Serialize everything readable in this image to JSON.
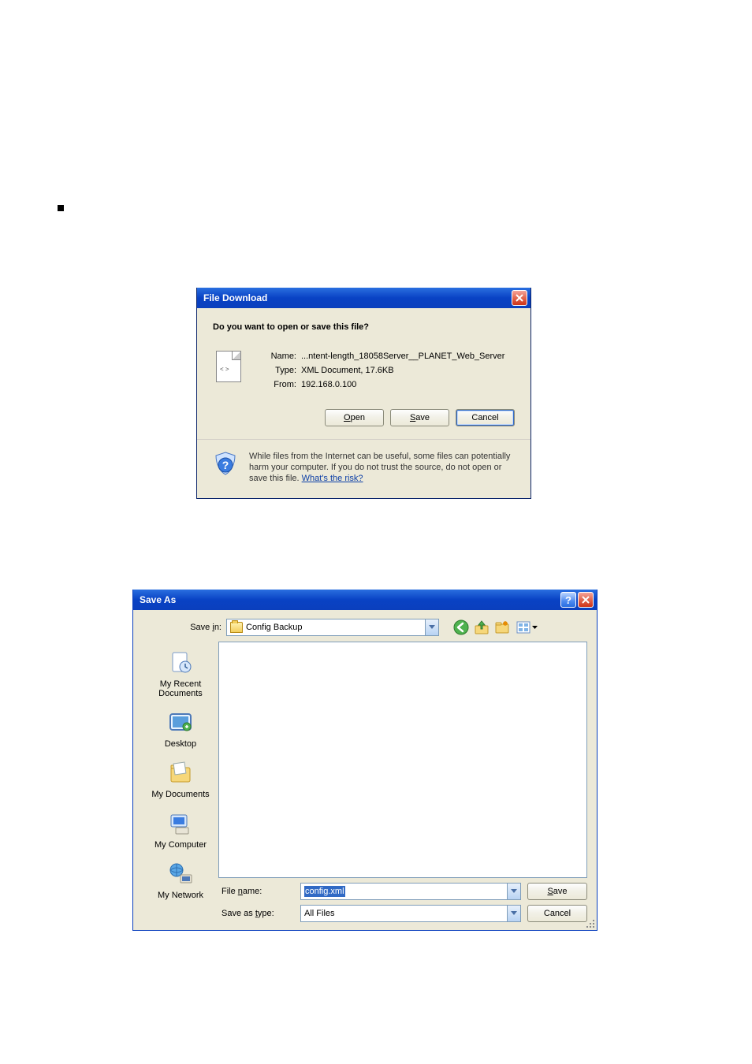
{
  "bullet": "■",
  "file_download": {
    "title": "File Download",
    "question": "Do you want to open or save this file?",
    "meta": {
      "name_label": "Name:",
      "name_value": "...ntent-length_18058Server__PLANET_Web_Server",
      "type_label": "Type:",
      "type_value": "XML Document, 17.6KB",
      "from_label": "From:",
      "from_value": "192.168.0.100"
    },
    "buttons": {
      "open": "Open",
      "save": "Save",
      "cancel": "Cancel"
    },
    "warning_text": "While files from the Internet can be useful, some files can potentially harm your computer. If you do not trust the source, do not open or save this file. ",
    "warning_link": "What's the risk?"
  },
  "save_as": {
    "title": "Save As",
    "save_in_label": "Save in:",
    "save_in_value": "Config Backup",
    "toolbar_icons": {
      "back": "back-icon",
      "up": "up-one-level-icon",
      "new_folder": "create-new-folder-icon",
      "views": "views-icon"
    },
    "places": [
      {
        "id": "recent",
        "label": "My Recent Documents"
      },
      {
        "id": "desktop",
        "label": "Desktop"
      },
      {
        "id": "mydocs",
        "label": "My Documents"
      },
      {
        "id": "computer",
        "label": "My Computer"
      },
      {
        "id": "network",
        "label": "My Network"
      }
    ],
    "file_name_label": "File name:",
    "file_name_value": "config.xml",
    "save_type_label": "Save as type:",
    "save_type_value": "All Files",
    "buttons": {
      "save": "Save",
      "cancel": "Cancel"
    }
  }
}
